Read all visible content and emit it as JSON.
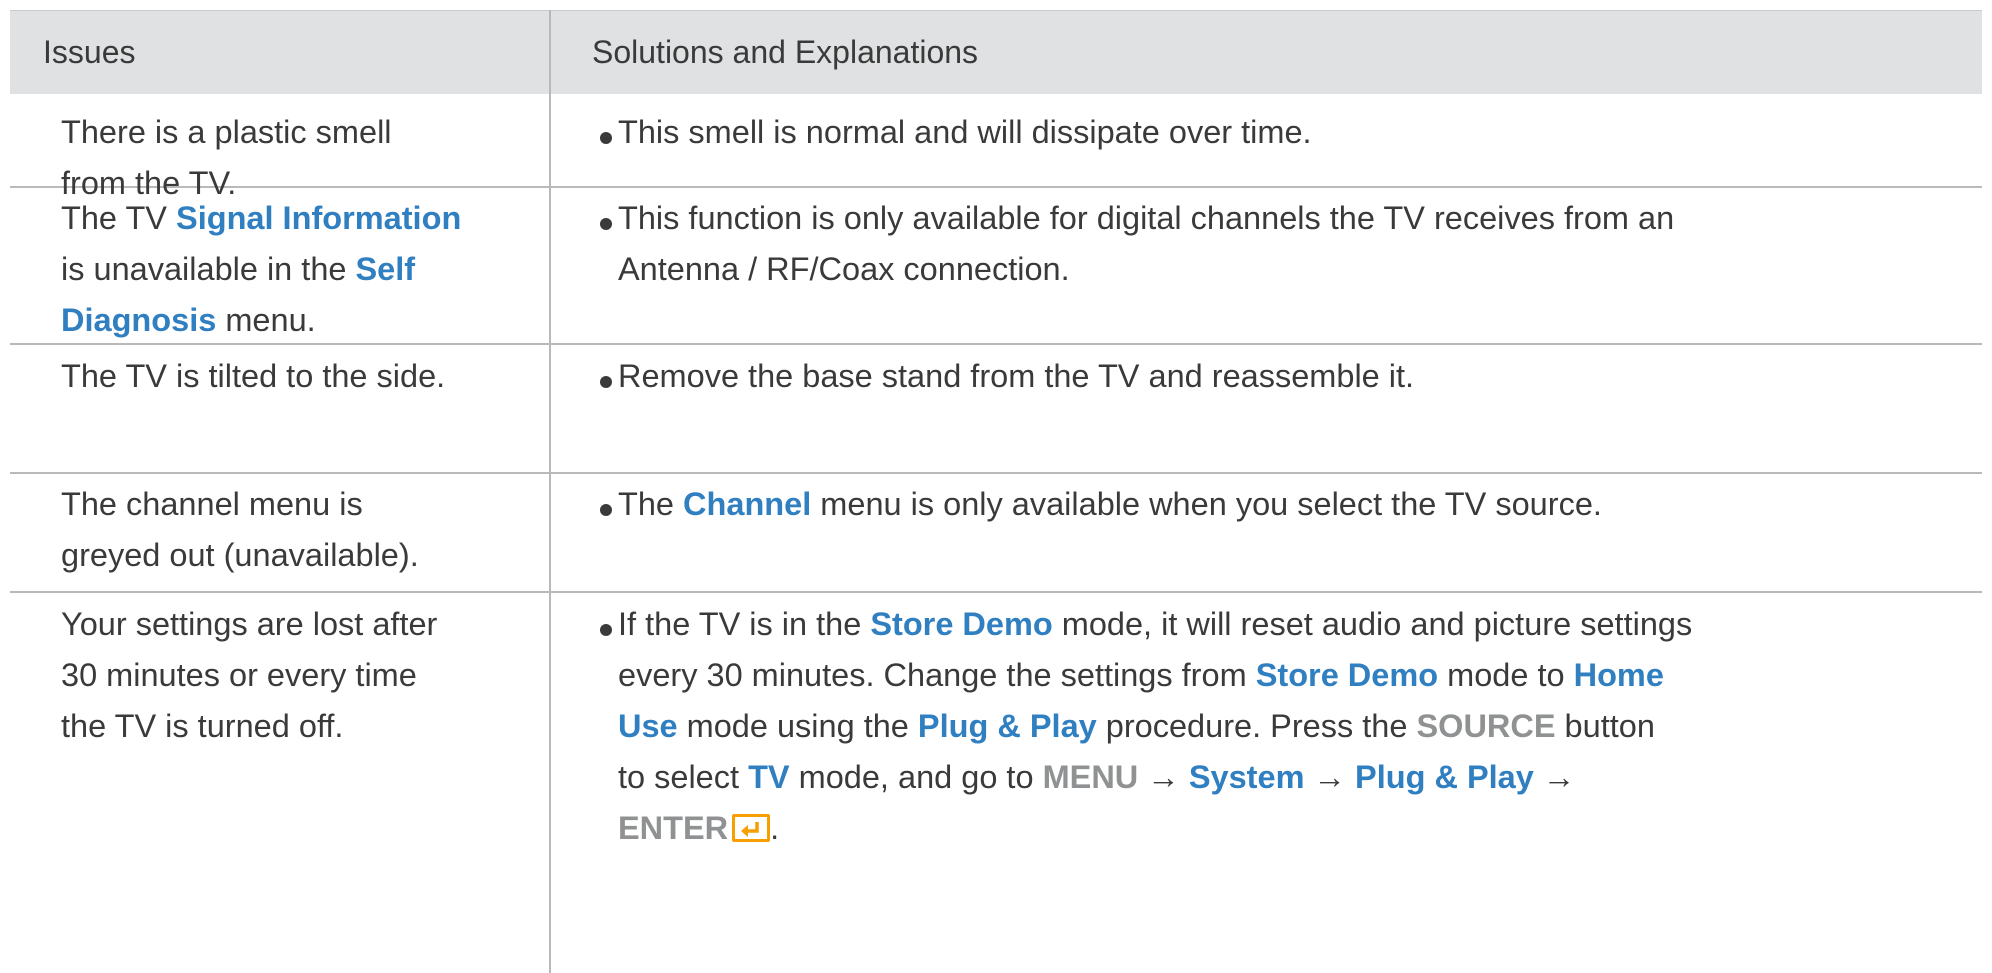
{
  "header": {
    "issues": "Issues",
    "solutions": "Solutions and Explanations"
  },
  "rows": [
    {
      "issue": [
        "There is a plastic smell",
        "from the TV."
      ],
      "solution": [
        "This smell is normal and will dissipate over time."
      ]
    },
    {
      "issue_parts": {
        "l1a": "The TV ",
        "l1b": "Signal Information",
        "l2a": "is unavailable in the ",
        "l2b": "Self",
        "l3a": "Diagnosis",
        "l3b": " menu."
      },
      "solution": [
        "This function is only available for digital channels the TV receives from an",
        "Antenna / RF/Coax connection."
      ]
    },
    {
      "issue": [
        "The TV is tilted to the side."
      ],
      "solution": [
        "Remove the base stand from the TV and reassemble it."
      ]
    },
    {
      "issue": [
        "The channel menu is",
        "greyed out (unavailable)."
      ],
      "solution_parts": {
        "a": "The ",
        "b": "Channel",
        "c": " menu is only available when you select the TV source."
      }
    },
    {
      "issue": [
        "Your settings are lost after",
        "30 minutes or every time",
        "the TV is turned off."
      ],
      "solution_parts": {
        "l1a": "If the TV is in the ",
        "l1b": "Store Demo",
        "l1c": " mode, it will reset audio and picture settings",
        "l2a": "every 30 minutes. Change the settings from ",
        "l2b": "Store Demo",
        "l2c": " mode to ",
        "l2d": "Home",
        "l3a": "Use",
        "l3b": " mode using the ",
        "l3c": "Plug & Play",
        "l3d": " procedure. Press the ",
        "l3e": "SOURCE",
        "l3f": " button",
        "l4a": "to select ",
        "l4b": "TV",
        "l4c": " mode, and go to ",
        "l4d": "MENU",
        "l4e": " → ",
        "l4f": "System",
        "l4g": " → ",
        "l4h": "Plug & Play",
        "l4i": " →",
        "l5a": "ENTER",
        "l5b": "."
      }
    }
  ],
  "colors": {
    "highlight": "#2f7fc1",
    "key": "#8f9192",
    "header_bg": "#dfe1e2",
    "enter_icon": "#f5a000"
  },
  "icons": {
    "enter": "enter-return-icon"
  }
}
